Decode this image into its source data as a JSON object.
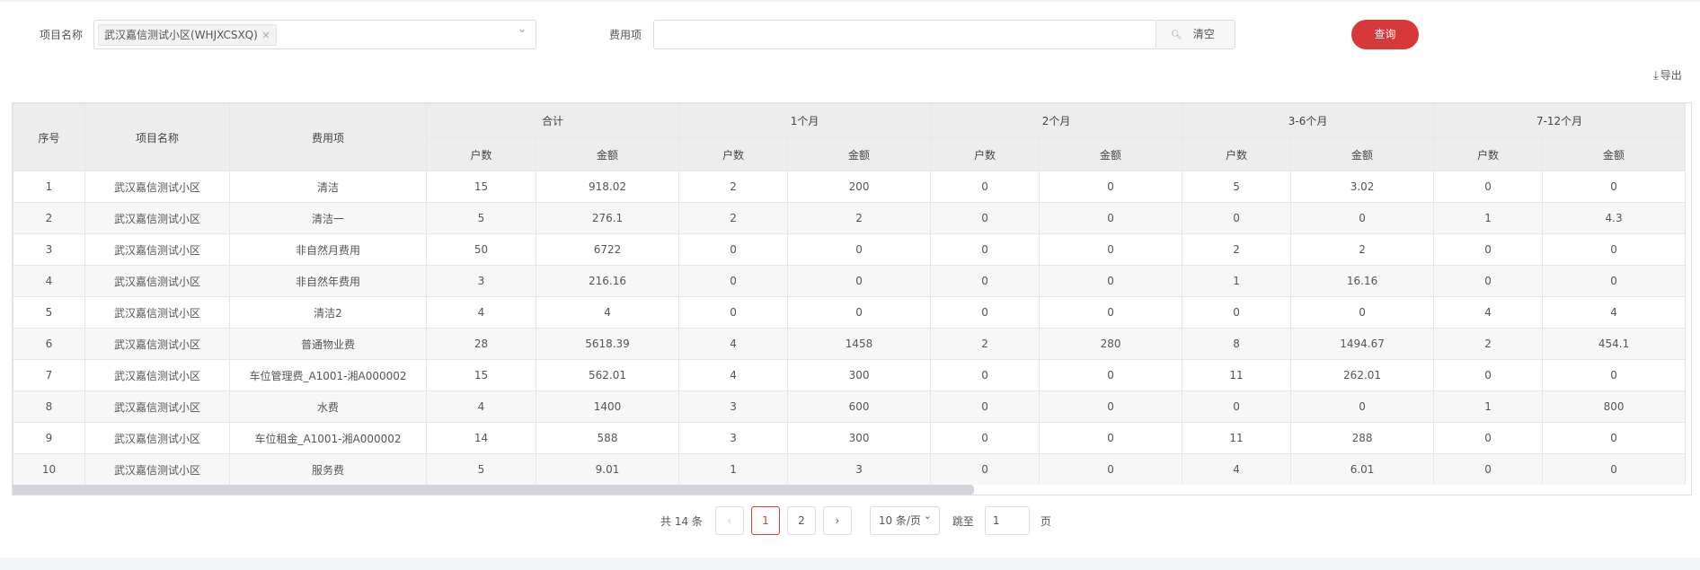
{
  "filters": {
    "project_label": "项目名称",
    "project_tag": "武汉嘉信测试小区(WHJXCSXQ)",
    "fee_label": "费用项",
    "fee_value": "",
    "clear_label": "清空",
    "query_label": "查询",
    "export_label": "导出"
  },
  "table": {
    "headers": {
      "index": "序号",
      "project": "项目名称",
      "fee": "费用项"
    },
    "groups": [
      "合计",
      "1个月",
      "2个月",
      "3-6个月",
      "7-12个月"
    ],
    "sub": {
      "households": "户数",
      "amount": "金额"
    },
    "rows": [
      [
        "1",
        "武汉嘉信测试小区",
        "清洁",
        "15",
        "918.02",
        "2",
        "200",
        "0",
        "0",
        "5",
        "3.02",
        "0",
        "0"
      ],
      [
        "2",
        "武汉嘉信测试小区",
        "清洁一",
        "5",
        "276.1",
        "2",
        "2",
        "0",
        "0",
        "0",
        "0",
        "1",
        "4.3"
      ],
      [
        "3",
        "武汉嘉信测试小区",
        "非自然月费用",
        "50",
        "6722",
        "0",
        "0",
        "0",
        "0",
        "2",
        "2",
        "0",
        "0"
      ],
      [
        "4",
        "武汉嘉信测试小区",
        "非自然年费用",
        "3",
        "216.16",
        "0",
        "0",
        "0",
        "0",
        "1",
        "16.16",
        "0",
        "0"
      ],
      [
        "5",
        "武汉嘉信测试小区",
        "清洁2",
        "4",
        "4",
        "0",
        "0",
        "0",
        "0",
        "0",
        "0",
        "4",
        "4"
      ],
      [
        "6",
        "武汉嘉信测试小区",
        "普通物业费",
        "28",
        "5618.39",
        "4",
        "1458",
        "2",
        "280",
        "8",
        "1494.67",
        "2",
        "454.1"
      ],
      [
        "7",
        "武汉嘉信测试小区",
        "车位管理费_A1001-湘A000002",
        "15",
        "562.01",
        "4",
        "300",
        "0",
        "0",
        "11",
        "262.01",
        "0",
        "0"
      ],
      [
        "8",
        "武汉嘉信测试小区",
        "水费",
        "4",
        "1400",
        "3",
        "600",
        "0",
        "0",
        "0",
        "0",
        "1",
        "800"
      ],
      [
        "9",
        "武汉嘉信测试小区",
        "车位租金_A1001-湘A000002",
        "14",
        "588",
        "3",
        "300",
        "0",
        "0",
        "11",
        "288",
        "0",
        "0"
      ],
      [
        "10",
        "武汉嘉信测试小区",
        "服务费",
        "5",
        "9.01",
        "1",
        "3",
        "0",
        "0",
        "4",
        "6.01",
        "0",
        "0"
      ]
    ]
  },
  "pagination": {
    "total": "共 14 条",
    "prev": "‹",
    "pages": [
      "1",
      "2"
    ],
    "next": "›",
    "page_size": "10 条/页",
    "jump_label": "跳至",
    "jump_value": "1",
    "page_suffix": "页"
  }
}
